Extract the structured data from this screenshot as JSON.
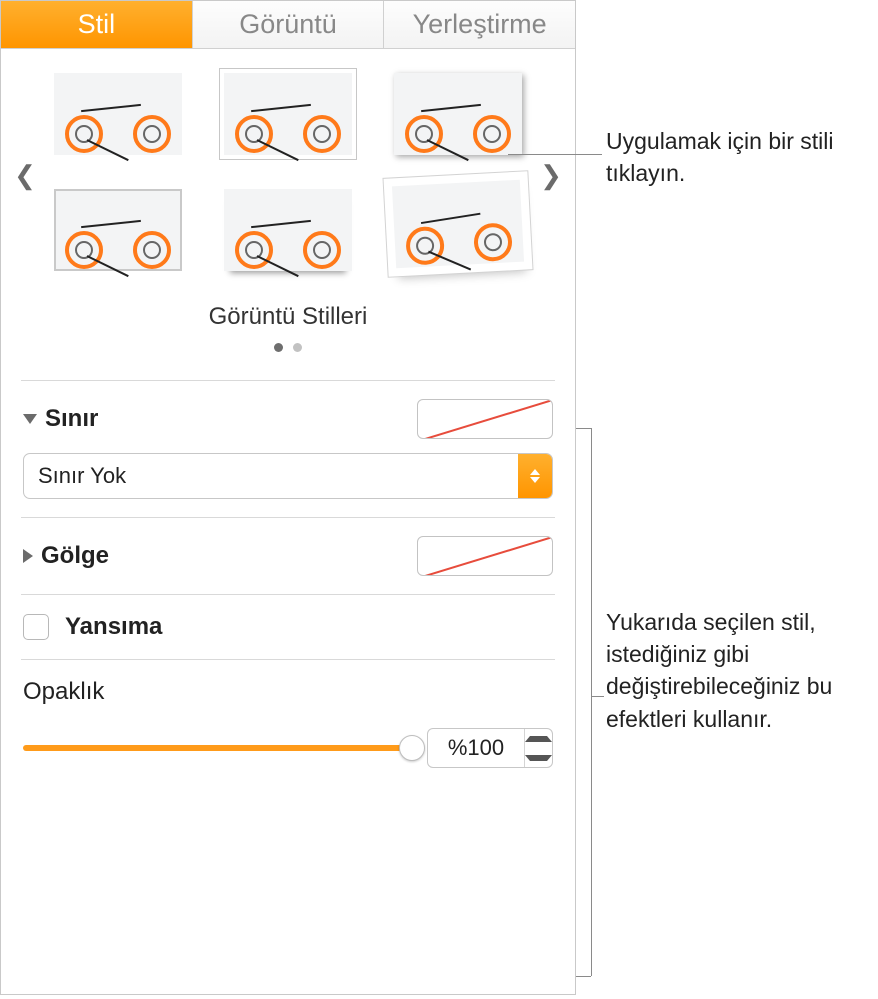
{
  "tabs": {
    "style": "Stil",
    "image": "Görüntü",
    "arrange": "Yerleştirme"
  },
  "styles": {
    "heading": "Görüntü Stilleri"
  },
  "border": {
    "label": "Sınır",
    "dropdown_value": "Sınır Yok"
  },
  "shadow": {
    "label": "Gölge"
  },
  "reflection": {
    "label": "Yansıma"
  },
  "opacity": {
    "label": "Opaklık",
    "value": "%100"
  },
  "callouts": {
    "click_to_apply": "Uygulamak için bir stili tıklayın.",
    "effects_note": "Yukarıda seçilen stil, istediğiniz gibi değiştirebileceğiniz bu efektleri kullanır."
  }
}
